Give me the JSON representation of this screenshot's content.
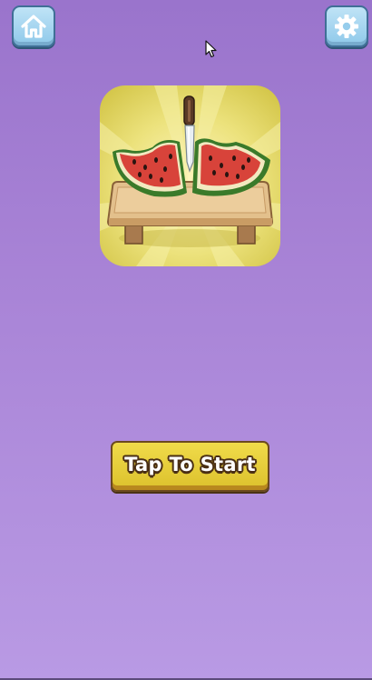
{
  "screen": "title",
  "colors": {
    "background_top": "#9a74cc",
    "background_bottom": "#b99ae4",
    "icon_button": "#a9d6f0",
    "start_button": "#e8d03c"
  },
  "top_bar": {
    "home_icon": "home-icon",
    "settings_icon": "gear-icon"
  },
  "logo": {
    "icon": "watermelon-knife-cutting-board"
  },
  "start_button": {
    "label": "Tap To Start"
  }
}
